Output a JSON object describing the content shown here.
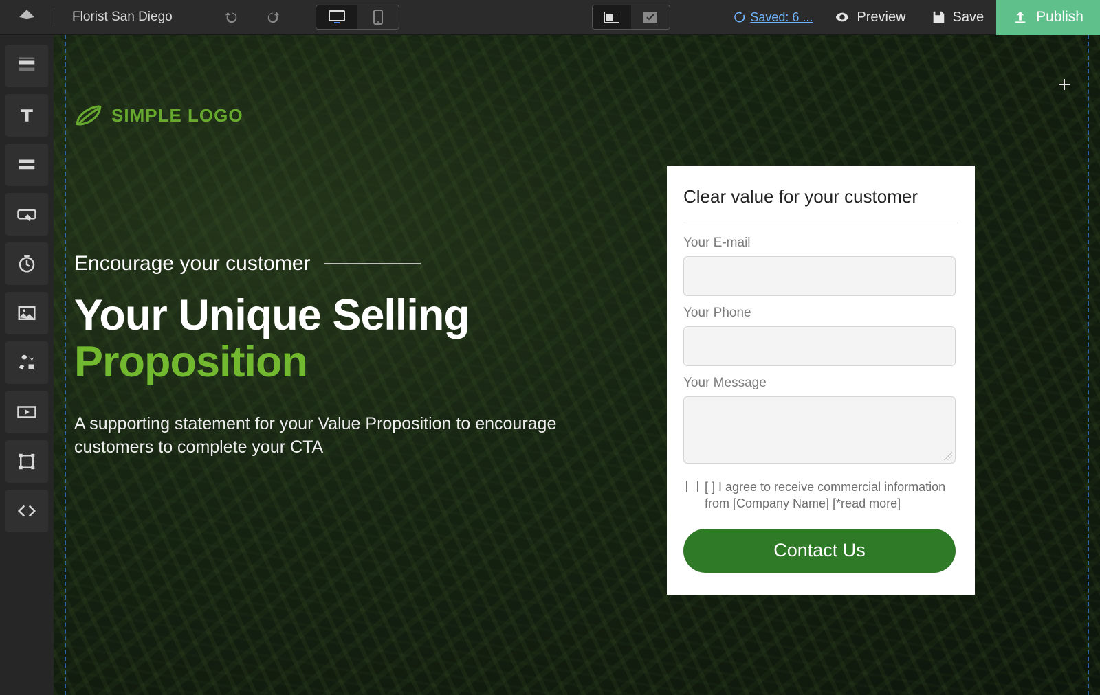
{
  "topbar": {
    "project_title": "Florist San Diego",
    "saved_label": " Saved: 6 ...",
    "preview_label": "Preview",
    "save_label": "Save",
    "publish_label": "Publish"
  },
  "sidebar_tools": [
    {
      "name": "section-tool"
    },
    {
      "name": "text-tool"
    },
    {
      "name": "form-tool"
    },
    {
      "name": "button-tool"
    },
    {
      "name": "timer-tool"
    },
    {
      "name": "image-tool"
    },
    {
      "name": "icons-tool"
    },
    {
      "name": "video-tool"
    },
    {
      "name": "shape-tool"
    },
    {
      "name": "code-tool"
    }
  ],
  "hero": {
    "logo_text": "SIMPLE LOGO",
    "eyebrow": "Encourage your customer",
    "headline_line1": "Your Unique Selling",
    "headline_line2_accent": "Proposition",
    "subcopy": "A supporting statement for your Value Proposition to encourage customers to complete your CTA"
  },
  "form": {
    "title": "Clear value for your customer",
    "email_label": "Your E-mail",
    "phone_label": "Your Phone",
    "message_label": "Your Message",
    "consent_text": "[ ] I agree to receive commercial information from [Company Name] [*read more]",
    "cta_label": "Contact Us"
  },
  "colors": {
    "accent_green": "#72b92f",
    "publish_green": "#5fc08c",
    "cta_green": "#2f7a27",
    "link_blue": "#6fb3ff"
  }
}
